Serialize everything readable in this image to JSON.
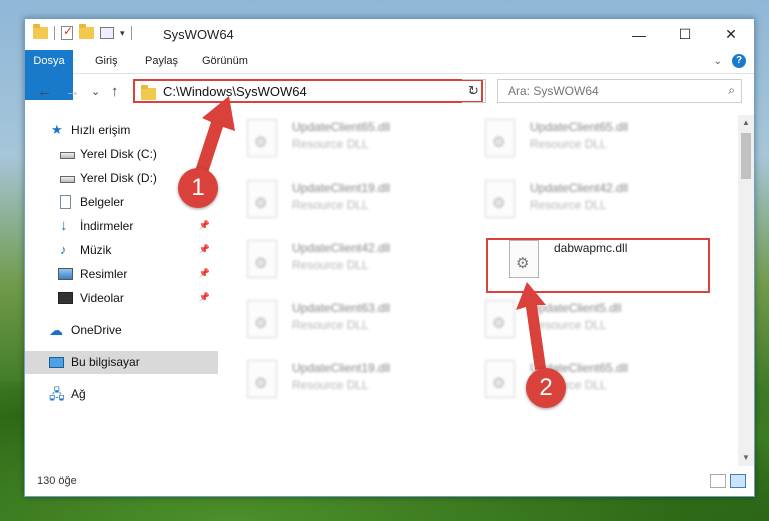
{
  "window": {
    "title": "SysWOW64",
    "controls": {
      "minimize": "—",
      "maximize": "☐",
      "close": "✕"
    }
  },
  "ribbon": {
    "tabs": [
      "Dosya",
      "Giriş",
      "Paylaş",
      "Görünüm"
    ]
  },
  "navigation": {
    "back": "←",
    "forward": "→",
    "recent": "⌄",
    "up": "↑",
    "address_path": "C:\\Windows\\SysWOW64",
    "refresh": "↻",
    "search_placeholder": "Ara: SysWOW64"
  },
  "sidebar": {
    "items": [
      {
        "label": "Hızlı erişim",
        "icon": "star-icon",
        "pinned": false
      },
      {
        "label": "Yerel Disk (C:)",
        "icon": "drive-icon",
        "pinned": false
      },
      {
        "label": "Yerel Disk (D:)",
        "icon": "drive-icon",
        "pinned": false
      },
      {
        "label": "Belgeler",
        "icon": "documents-icon",
        "pinned": false
      },
      {
        "label": "İndirmeler",
        "icon": "download-icon",
        "pinned": true
      },
      {
        "label": "Müzik",
        "icon": "music-icon",
        "pinned": true
      },
      {
        "label": "Resimler",
        "icon": "pictures-icon",
        "pinned": true
      },
      {
        "label": "Videolar",
        "icon": "videos-icon",
        "pinned": true
      },
      {
        "label": "OneDrive",
        "icon": "cloud-icon",
        "pinned": false
      },
      {
        "label": "Bu bilgisayar",
        "icon": "computer-icon",
        "pinned": false,
        "selected": true
      },
      {
        "label": "Ağ",
        "icon": "network-icon",
        "pinned": false
      }
    ]
  },
  "files": {
    "left_column": [
      {
        "name": "UpdateClient65.dll",
        "type": "Resource DLL"
      },
      {
        "name": "UpdateClient19.dll",
        "type": "Resource DLL"
      },
      {
        "name": "UpdateClient42.dll",
        "type": "Resource DLL"
      },
      {
        "name": "UpdateClient63.dll",
        "type": "Resource DLL"
      },
      {
        "name": "UpdateClient19.dll",
        "type": "Resource DLL"
      }
    ],
    "right_column": [
      {
        "name": "UpdateClient65.dll",
        "type": "Resource DLL"
      },
      {
        "name": "UpdateClient42.dll",
        "type": "Resource DLL"
      },
      {
        "name": "dabwapmc.dll",
        "type": ""
      },
      {
        "name": "UpdateClient5.dll",
        "type": "Resource DLL"
      },
      {
        "name": "UpdateClient65.dll",
        "type": "Resource DLL"
      }
    ]
  },
  "status": {
    "item_count": "130 öğe"
  },
  "annotations": {
    "step1": "1",
    "step2": "2",
    "color": "#d9413a"
  }
}
